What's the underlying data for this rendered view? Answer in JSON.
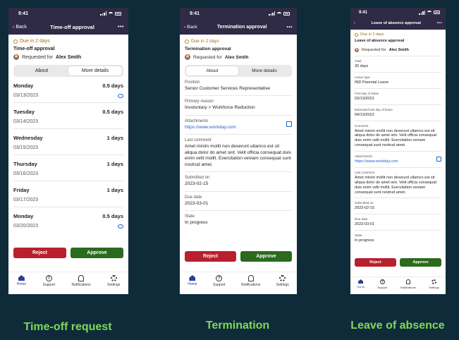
{
  "status_time": "9:41",
  "common": {
    "back": "Back",
    "more": "•••",
    "due": "Due in 2 days",
    "requested_for": "Requested for",
    "requester": "Alex Smith",
    "reject": "Reject",
    "approve": "Approve",
    "tabs": [
      "Home",
      "Support",
      "Notifications",
      "Settings"
    ]
  },
  "timeoff": {
    "nav_title": "Time-off approval",
    "title": "Time-off approval",
    "seg": [
      "About",
      "More details"
    ],
    "days": [
      {
        "day": "Monday",
        "amount": "0.5 days",
        "date": "03/13/2023"
      },
      {
        "day": "Tuesday",
        "amount": "0.5 days",
        "date": "03/14/2023"
      },
      {
        "day": "Wednesday",
        "amount": "1 days",
        "date": "03/15/2023"
      },
      {
        "day": "Thursday",
        "amount": "1 days",
        "date": "03/16/2023"
      },
      {
        "day": "Friday",
        "amount": "1 days",
        "date": "03/17/2023"
      },
      {
        "day": "Monday",
        "amount": "0.5 days",
        "date": "03/20/2023"
      }
    ],
    "caption": "Time-off request"
  },
  "termination": {
    "nav_title": "Termination approval",
    "title": "Termination approval",
    "seg": [
      "About",
      "More details"
    ],
    "position_label": "Position",
    "position": "Senior Customer Services Representative",
    "reason_label": "Primary reason",
    "reason": "Involuntary > Workforce Reduction",
    "attachments_label": "Attachments",
    "attachments": "https://www.workday.com",
    "comment_label": "Last comment",
    "comment": "Amet minim mollit non deserunt ullamco est sit aliqua dolor do amet sint. Velit officia consequat duis enim velit mollit. Exercitation veniam consequat sunt nostrud amet.",
    "submitted_label": "Submitted on",
    "submitted": "2023-02-15",
    "due_label": "Due date",
    "due_date": "2023-03-01",
    "state_label": "State",
    "state": "In progress",
    "caption": "Termination"
  },
  "leave": {
    "nav_title": "Leave of absence approval",
    "title": "Leave of absence approval",
    "total_label": "Total",
    "total": "30 days",
    "type_label": "Leave type",
    "type": "IND Parental Leave",
    "first_label": "First day of leave",
    "first": "03/13/2023",
    "last_label": "Estimated last day of leave",
    "last": "04/13/2023",
    "comment_label": "Comment",
    "comment": "Amet minim mollit non deserunt ullamco est sit aliqua dolor do amet sint. Velit officia consequat duis enim velit mollit. Exercitation veniam consequat sunt nostrud amet.",
    "attachments_label": "Attachments",
    "attachments": "https://www.workday.com",
    "last_comment_label": "Last comment",
    "last_comment": "Amet minim mollit non deserunt ullamco est sit aliqua dolor do amet sint. Velit officia consequat duis enim velit mollit. Exercitation veniam consequat sunt nostrud amet.",
    "submitted_label": "Submitted on",
    "submitted": "2023-02-15",
    "due_label": "Due date",
    "due_date": "2023-03-01",
    "state_label": "State",
    "state": "In progress",
    "caption": "Leave of absence"
  }
}
